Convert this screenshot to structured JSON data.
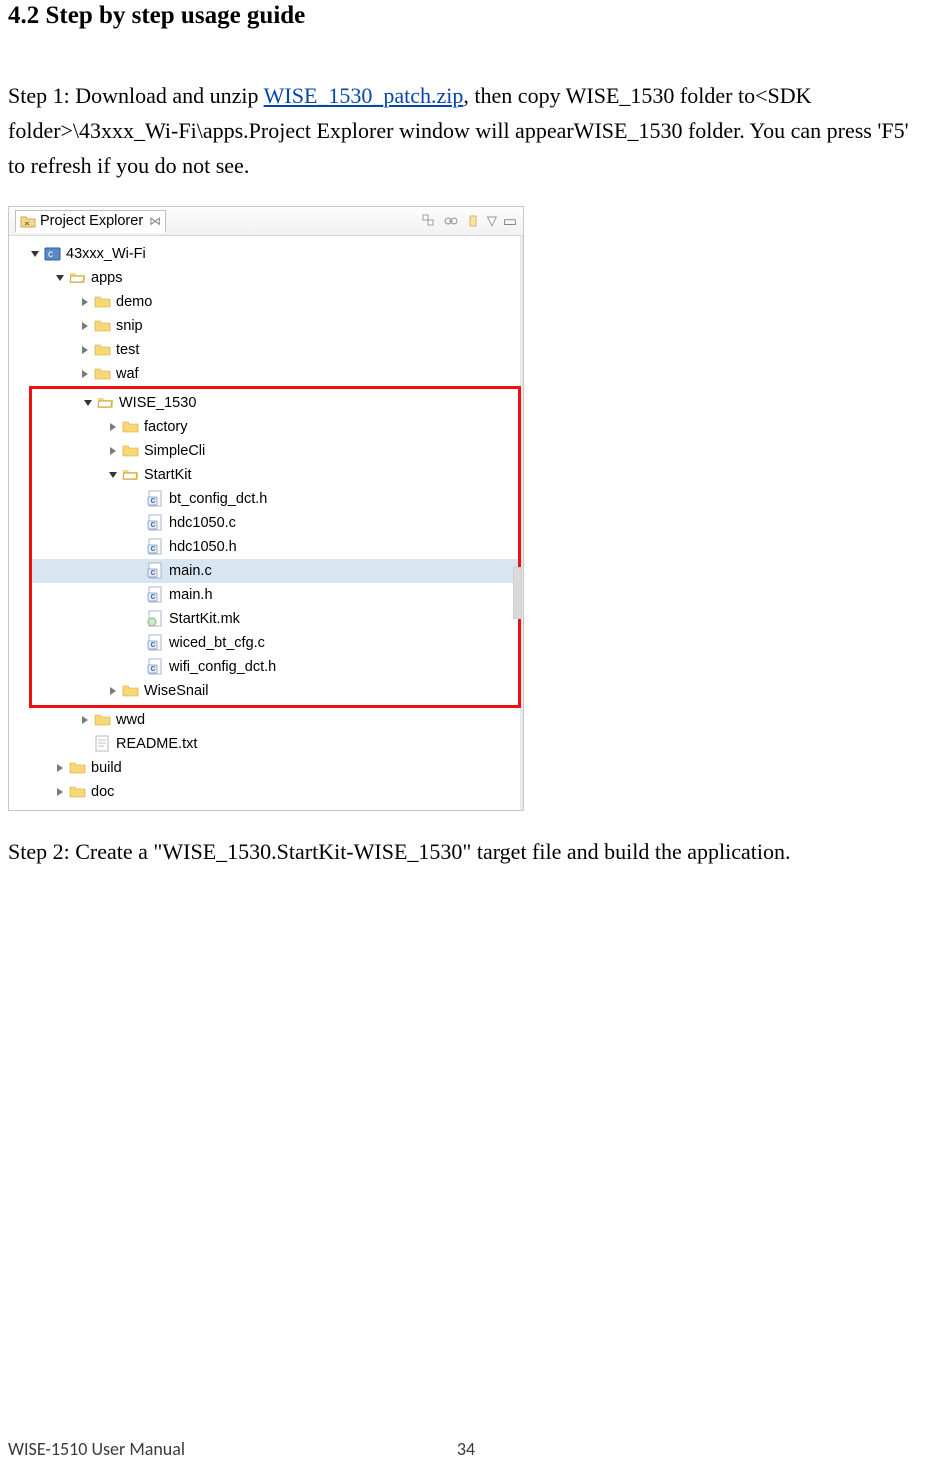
{
  "heading": "4.2 Step by step usage guide",
  "step1": {
    "prefix": "Step 1: Download and unzip ",
    "link": "WISE_1530_patch.zip",
    "mid": ", then copy WISE_1530 folder to<SDK folder>\\43xxx_Wi-Fi\\apps.Project Explorer window will appearWISE_1530 folder. You can press 'F5' to refresh if you do not see."
  },
  "explorer": {
    "tab_label": "Project Explorer",
    "root": "43xxx_Wi-Fi",
    "apps": "apps",
    "apps_children": [
      "demo",
      "snip",
      "test",
      "waf"
    ],
    "wise": "WISE_1530",
    "wise_children_folders": [
      "factory",
      "SimpleCli"
    ],
    "startkit": "StartKit",
    "startkit_files": [
      "bt_config_dct.h",
      "hdc1050.c",
      "hdc1050.h",
      "main.c",
      "main.h",
      "StartKit.mk",
      "wiced_bt_cfg.c",
      "wifi_config_dct.h"
    ],
    "wisesnail": "WiseSnail",
    "wwd": "wwd",
    "readme": "README.txt",
    "build": "build",
    "doc": "doc"
  },
  "step2": "Step 2: Create a \"WISE_1530.StartKit-WISE_1530\" target file and build the application.",
  "footer": {
    "doc": "WISE-1510 User Manual",
    "page": "34"
  }
}
